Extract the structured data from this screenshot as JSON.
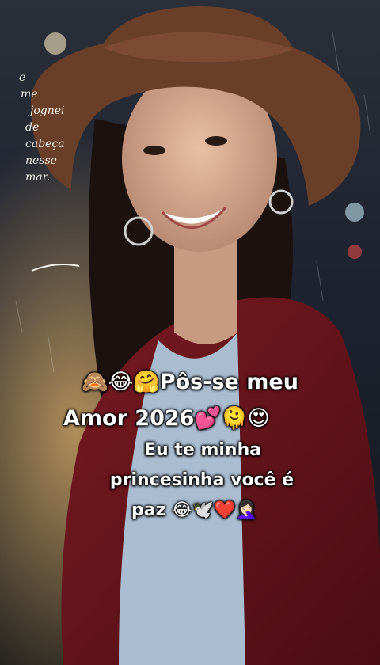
{
  "handwriting": [
    "e",
    "me",
    "jognei",
    "de",
    "cabeça",
    "nesse",
    "mar."
  ],
  "caption_main": {
    "line1": "🙈😂🤗Pôs-se meu",
    "line2": "Amor 2026💕🫠😍"
  },
  "caption_sub": {
    "line1": "Eu te minha",
    "line2": "princesinha você é",
    "line3": "paz 😂🕊️❤️🤦🏻‍♀️"
  }
}
